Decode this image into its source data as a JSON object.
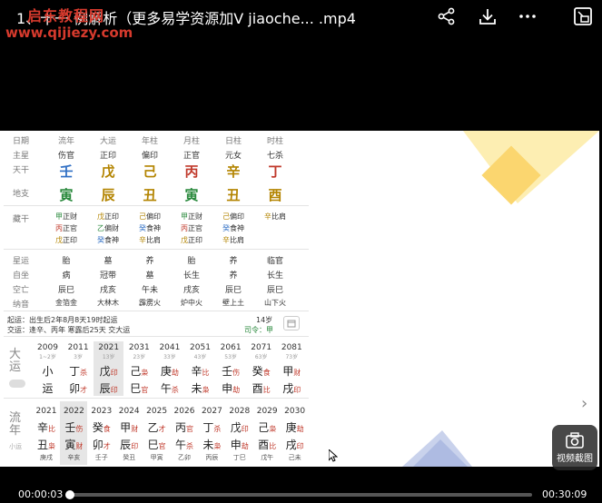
{
  "header": {
    "title": "1、十一   例解析（更多易学资源加V jiaoche... .mp4",
    "watermark_line1": "启东教程网",
    "watermark_line2": "www.qijiezy.com"
  },
  "toolbar": {
    "icons": [
      "share-icon",
      "download-icon",
      "more-icon",
      "pip-icon"
    ]
  },
  "chart": {
    "labels": {
      "riqi": "日期",
      "zhuxing": "主星",
      "tiangan": "天干",
      "dizhi": "地支",
      "canggan": "藏干",
      "xingyun": "星运",
      "zizuo": "自坐",
      "kongwang": "空亡",
      "nayin": "纳音"
    },
    "columns": [
      {
        "head": "流年",
        "star": "伤官",
        "gan": "壬",
        "zhi": "寅",
        "gan_color": "#2f6fc4",
        "zhi_color": "#2b8a3e",
        "hidden": [
          [
            "甲",
            "正财",
            "g"
          ],
          [
            "丙",
            "正官",
            "r"
          ],
          [
            "戊",
            "正印",
            "y"
          ]
        ],
        "xingyun": "胎",
        "zizuo": "病",
        "kong": "辰巳",
        "nayin": "金箔金"
      },
      {
        "head": "大运",
        "star": "正印",
        "gan": "戊",
        "zhi": "辰",
        "gan_color": "#b38400",
        "zhi_color": "#b38400",
        "hidden": [
          [
            "戊",
            "正印",
            "y"
          ],
          [
            "乙",
            "偏财",
            "g"
          ],
          [
            "癸",
            "食神",
            "b"
          ]
        ],
        "xingyun": "墓",
        "zizuo": "冠带",
        "kong": "戌亥",
        "nayin": "大林木"
      },
      {
        "head": "年柱",
        "star": "偏印",
        "gan": "己",
        "zhi": "丑",
        "gan_color": "#b38400",
        "zhi_color": "#b38400",
        "hidden": [
          [
            "己",
            "偏印",
            "y"
          ],
          [
            "癸",
            "食神",
            "b"
          ],
          [
            "辛",
            "比肩",
            "y"
          ]
        ],
        "xingyun": "养",
        "zizuo": "墓",
        "kong": "午未",
        "nayin": "霹雳火"
      },
      {
        "head": "月柱",
        "star": "正官",
        "gan": "丙",
        "zhi": "寅",
        "gan_color": "#c0392b",
        "zhi_color": "#2b8a3e",
        "hidden": [
          [
            "甲",
            "正财",
            "g"
          ],
          [
            "丙",
            "正官",
            "r"
          ],
          [
            "戊",
            "正印",
            "y"
          ]
        ],
        "xingyun": "胎",
        "zizuo": "长生",
        "kong": "戌亥",
        "nayin": "炉中火"
      },
      {
        "head": "日柱",
        "star": "元女",
        "gan": "辛",
        "zhi": "丑",
        "gan_color": "#b38400",
        "zhi_color": "#b38400",
        "hidden": [
          [
            "己",
            "偏印",
            "y"
          ],
          [
            "癸",
            "食神",
            "b"
          ],
          [
            "辛",
            "比肩",
            "y"
          ]
        ],
        "xingyun": "养",
        "zizuo": "养",
        "kong": "辰巳",
        "nayin": "壁上土"
      },
      {
        "head": "时柱",
        "star": "七杀",
        "gan": "丁",
        "zhi": "酉",
        "gan_color": "#c0392b",
        "zhi_color": "#b38400",
        "hidden": [
          [
            "辛",
            "比肩",
            "y"
          ]
        ],
        "xingyun": "临官",
        "zizuo": "长生",
        "kong": "辰巳",
        "nayin": "山下火"
      }
    ],
    "qiyun_line1": "起运：出生后2年8月8天19时起运",
    "qiyun_line2": "交运：逢辛、丙年 寒露后25天 交大运",
    "age_label": "14岁",
    "siling": "司令：甲",
    "dayun_label": "大运",
    "dayun": [
      {
        "year": "2009",
        "age": "1~2岁",
        "g": "小",
        "z": "运",
        "gs": "",
        "zs": ""
      },
      {
        "year": "2011",
        "age": "3岁",
        "g": "丁",
        "z": "卯",
        "gs": "杀",
        "zs": "才"
      },
      {
        "year": "2021",
        "age": "13岁",
        "g": "戊",
        "z": "辰",
        "gs": "印",
        "zs": "印"
      },
      {
        "year": "2031",
        "age": "23岁",
        "g": "己",
        "z": "巳",
        "gs": "枭",
        "zs": "官"
      },
      {
        "year": "2041",
        "age": "33岁",
        "g": "庚",
        "z": "午",
        "gs": "劫",
        "zs": "杀"
      },
      {
        "year": "2051",
        "age": "43岁",
        "g": "辛",
        "z": "未",
        "gs": "比",
        "zs": "枭"
      },
      {
        "year": "2061",
        "age": "53岁",
        "g": "壬",
        "z": "申",
        "gs": "伤",
        "zs": "劫"
      },
      {
        "year": "2071",
        "age": "63岁",
        "g": "癸",
        "z": "酉",
        "gs": "食",
        "zs": "比"
      },
      {
        "year": "2081",
        "age": "73岁",
        "g": "甲",
        "z": "戌",
        "gs": "财",
        "zs": "印"
      }
    ],
    "liunian_label": "流年",
    "liunian_sub": "小运",
    "liunian": [
      {
        "year": "2021",
        "g": "辛",
        "z": "丑",
        "gs": "比",
        "zs": "枭",
        "xy": "庚戌"
      },
      {
        "year": "2022",
        "g": "壬",
        "z": "寅",
        "gs": "伤",
        "zs": "财",
        "xy": "辛亥"
      },
      {
        "year": "2023",
        "g": "癸",
        "z": "卯",
        "gs": "食",
        "zs": "才",
        "xy": "壬子"
      },
      {
        "year": "2024",
        "g": "甲",
        "z": "辰",
        "gs": "财",
        "zs": "印",
        "xy": "癸丑"
      },
      {
        "year": "2025",
        "g": "乙",
        "z": "巳",
        "gs": "才",
        "zs": "官",
        "xy": "甲寅"
      },
      {
        "year": "2026",
        "g": "丙",
        "z": "午",
        "gs": "官",
        "zs": "杀",
        "xy": "乙卯"
      },
      {
        "year": "2027",
        "g": "丁",
        "z": "未",
        "gs": "杀",
        "zs": "枭",
        "xy": "丙辰"
      },
      {
        "year": "2028",
        "g": "戊",
        "z": "申",
        "gs": "印",
        "zs": "劫",
        "xy": "丁巳"
      },
      {
        "year": "2029",
        "g": "己",
        "z": "酉",
        "gs": "枭",
        "zs": "比",
        "xy": "戊午"
      },
      {
        "year": "2030",
        "g": "庚",
        "z": "戌",
        "gs": "劫",
        "zs": "印",
        "xy": "己未"
      }
    ]
  },
  "player": {
    "current_time": "00:00:03",
    "total_time": "00:30:09",
    "progress": 0.002,
    "screenshot_label": "视频截图"
  }
}
